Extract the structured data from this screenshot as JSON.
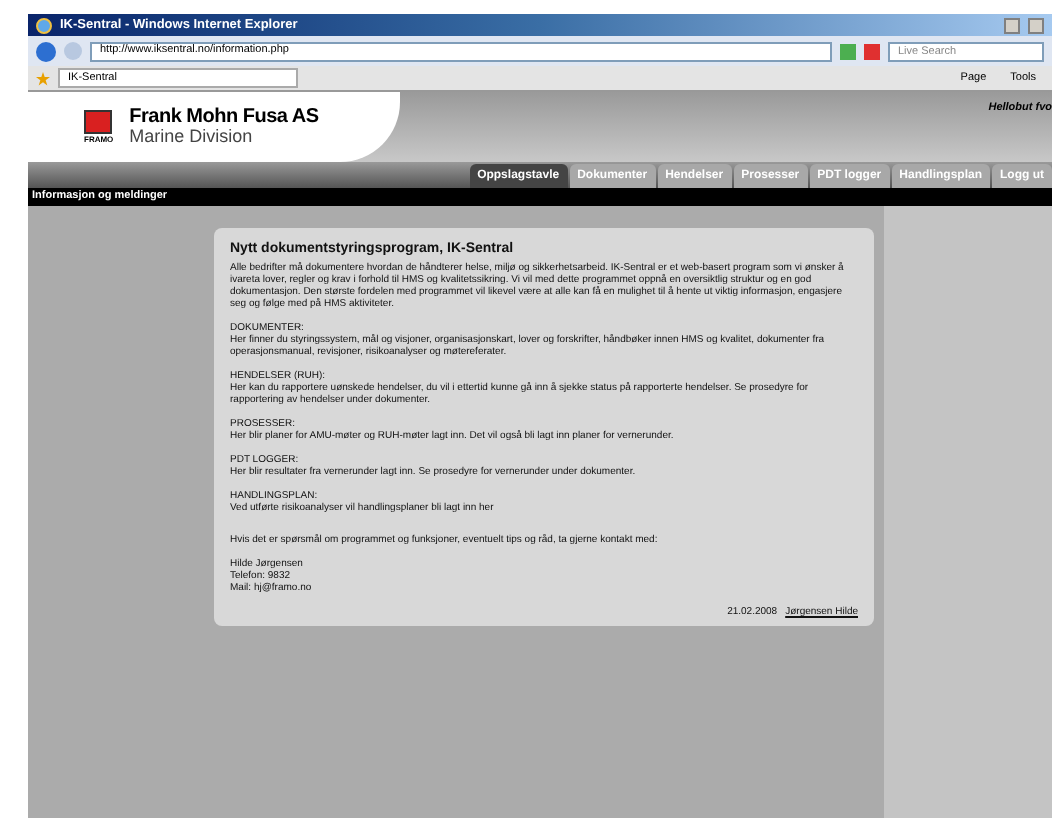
{
  "window": {
    "title": "IK-Sentral - Windows Internet Explorer"
  },
  "address_bar": {
    "url": "http://www.iksentral.no/information.php"
  },
  "search": {
    "placeholder": "Live Search"
  },
  "browser_tab": {
    "label": "IK-Sentral"
  },
  "command_bar": [
    "Page",
    "Tools"
  ],
  "header": {
    "company": "Frank Mohn Fusa AS",
    "division": "Marine Division",
    "logo_label": "FRAMO",
    "greeting": "Hellobut fvo"
  },
  "nav": [
    {
      "label": "Oppslagstavle",
      "selected": true
    },
    {
      "label": "Dokumenter",
      "selected": false
    },
    {
      "label": "Hendelser",
      "selected": false
    },
    {
      "label": "Prosesser",
      "selected": false
    },
    {
      "label": "PDT logger",
      "selected": false
    },
    {
      "label": "Handlingsplan",
      "selected": false
    },
    {
      "label": "Logg ut",
      "selected": false
    }
  ],
  "section_bar": "Informasjon og meldinger",
  "article": {
    "title": "Nytt dokumentstyringsprogram, IK-Sentral",
    "intro": "Alle bedrifter må dokumentere hvordan de håndterer helse, miljø og sikkerhetsarbeid. IK-Sentral er et web-basert program som vi ønsker å ivareta lover, regler og krav i forhold til HMS og kvalitetssikring. Vi vil med dette programmet oppnå en oversiktlig struktur og en god dokumentasjon. Den største fordelen med programmet vil likevel være at alle kan få en mulighet til å hente ut viktig informasjon, engasjere seg og følge med på HMS aktiviteter.",
    "sections": [
      {
        "heading": "DOKUMENTER:",
        "text": "Her finner du styringssystem, mål og visjoner, organisasjonskart, lover og forskrifter, håndbøker innen HMS og kvalitet, dokumenter fra operasjonsmanual, revisjoner, risikoanalyser og møtereferater."
      },
      {
        "heading": "HENDELSER (RUH):",
        "text": "Her kan du rapportere uønskede hendelser, du vil i ettertid kunne gå inn å sjekke status på rapporterte hendelser. Se prosedyre for rapportering av hendelser under dokumenter."
      },
      {
        "heading": "PROSESSER:",
        "text": "Her blir planer for AMU-møter og RUH-møter lagt inn. Det vil også bli lagt inn planer for vernerunder."
      },
      {
        "heading": "PDT LOGGER:",
        "text": "Her blir resultater fra vernerunder lagt inn. Se prosedyre for vernerunder under dokumenter."
      },
      {
        "heading": "HANDLINGSPLAN:",
        "text": "Ved utførte risikoanalyser vil handlingsplaner bli lagt inn her"
      }
    ],
    "closing": "Hvis det er spørsmål om programmet og funksjoner, eventuelt tips og råd, ta gjerne kontakt med:",
    "contact": [
      "Hilde Jørgensen",
      "Telefon: 9832",
      "Mail: hj@framo.no"
    ],
    "date": "21.02.2008",
    "author_link": "Jørgensen Hilde"
  }
}
